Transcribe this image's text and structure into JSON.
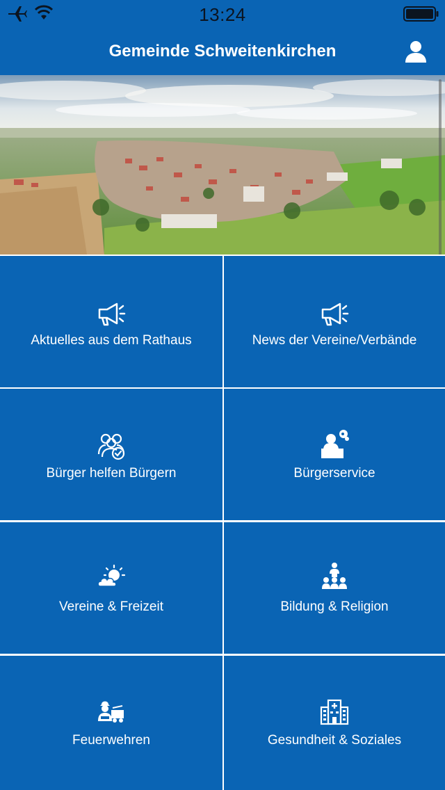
{
  "status_bar": {
    "time": "13:24",
    "icons": [
      "airplane-icon",
      "wifi-icon",
      "battery-icon"
    ]
  },
  "header": {
    "title": "Gemeinde Schweitenkirchen",
    "user_icon": "user-icon"
  },
  "hero_image": {
    "description_icon": "aerial-village-photo"
  },
  "tiles": [
    {
      "label": "Aktuelles aus dem Rathaus",
      "icon": "megaphone-icon"
    },
    {
      "label": "News der Vereine/Verbände",
      "icon": "megaphone-icon"
    },
    {
      "label": "Bürger helfen Bürgern",
      "icon": "people-group-check-icon"
    },
    {
      "label": "Bürgerservice",
      "icon": "service-desk-icon"
    },
    {
      "label": "Vereine & Freizeit",
      "icon": "sun-cloud-icon"
    },
    {
      "label": "Bildung & Religion",
      "icon": "teacher-students-icon"
    },
    {
      "label": "Feuerwehren",
      "icon": "firefighter-truck-icon"
    },
    {
      "label": "Gesundheit & Soziales",
      "icon": "hospital-icon"
    }
  ],
  "colors": {
    "primary_blue": "#0a64b4",
    "text_white": "#ffffff"
  }
}
